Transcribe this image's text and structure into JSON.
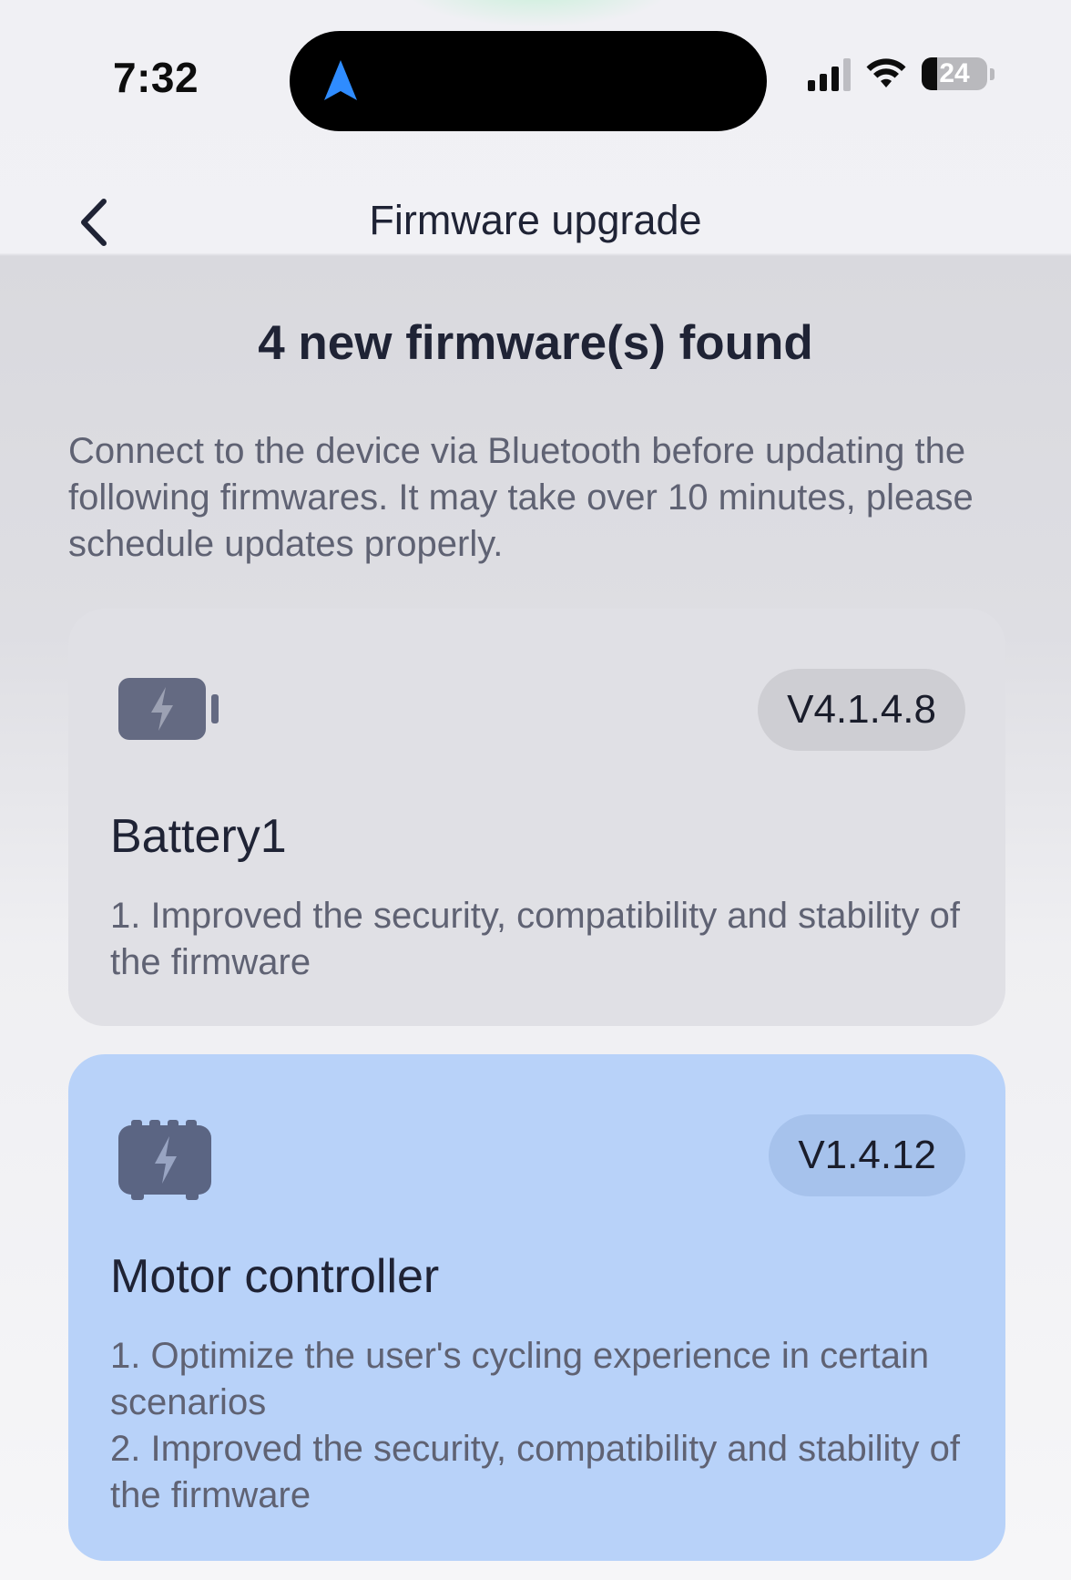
{
  "status_bar": {
    "time": "7:32",
    "battery_level": "24",
    "battery_fraction": 0.24,
    "icons": [
      "location-arrow-icon",
      "cellular-signal-icon",
      "wifi-icon",
      "battery-icon"
    ]
  },
  "header": {
    "back_icon": "chevron-left-icon",
    "title": "Firmware upgrade"
  },
  "main": {
    "found_title": "4 new firmware(s) found",
    "intro": "Connect to the device via Bluetooth before updating the following firmwares. It may take over 10 minutes, please schedule updates properly.",
    "firmwares": [
      {
        "icon": "battery-bolt-icon",
        "version": "V4.1.4.8",
        "name": "Battery1",
        "notes": [
          "1. Improved the security, compatibility and stability of the firmware"
        ]
      },
      {
        "icon": "motor-controller-bolt-icon",
        "version": "V1.4.12",
        "name": "Motor controller",
        "notes": [
          "1. Optimize the user's cycling experience in certain scenarios",
          "2. Improved the security, compatibility and stability of the firmware"
        ]
      }
    ]
  },
  "colors": {
    "accent_blue": "#2f8cff",
    "selected_card": "#b8d2f9",
    "card": "#e0e0e5",
    "title_text": "#1f2335",
    "body_text": "#5f6273"
  }
}
